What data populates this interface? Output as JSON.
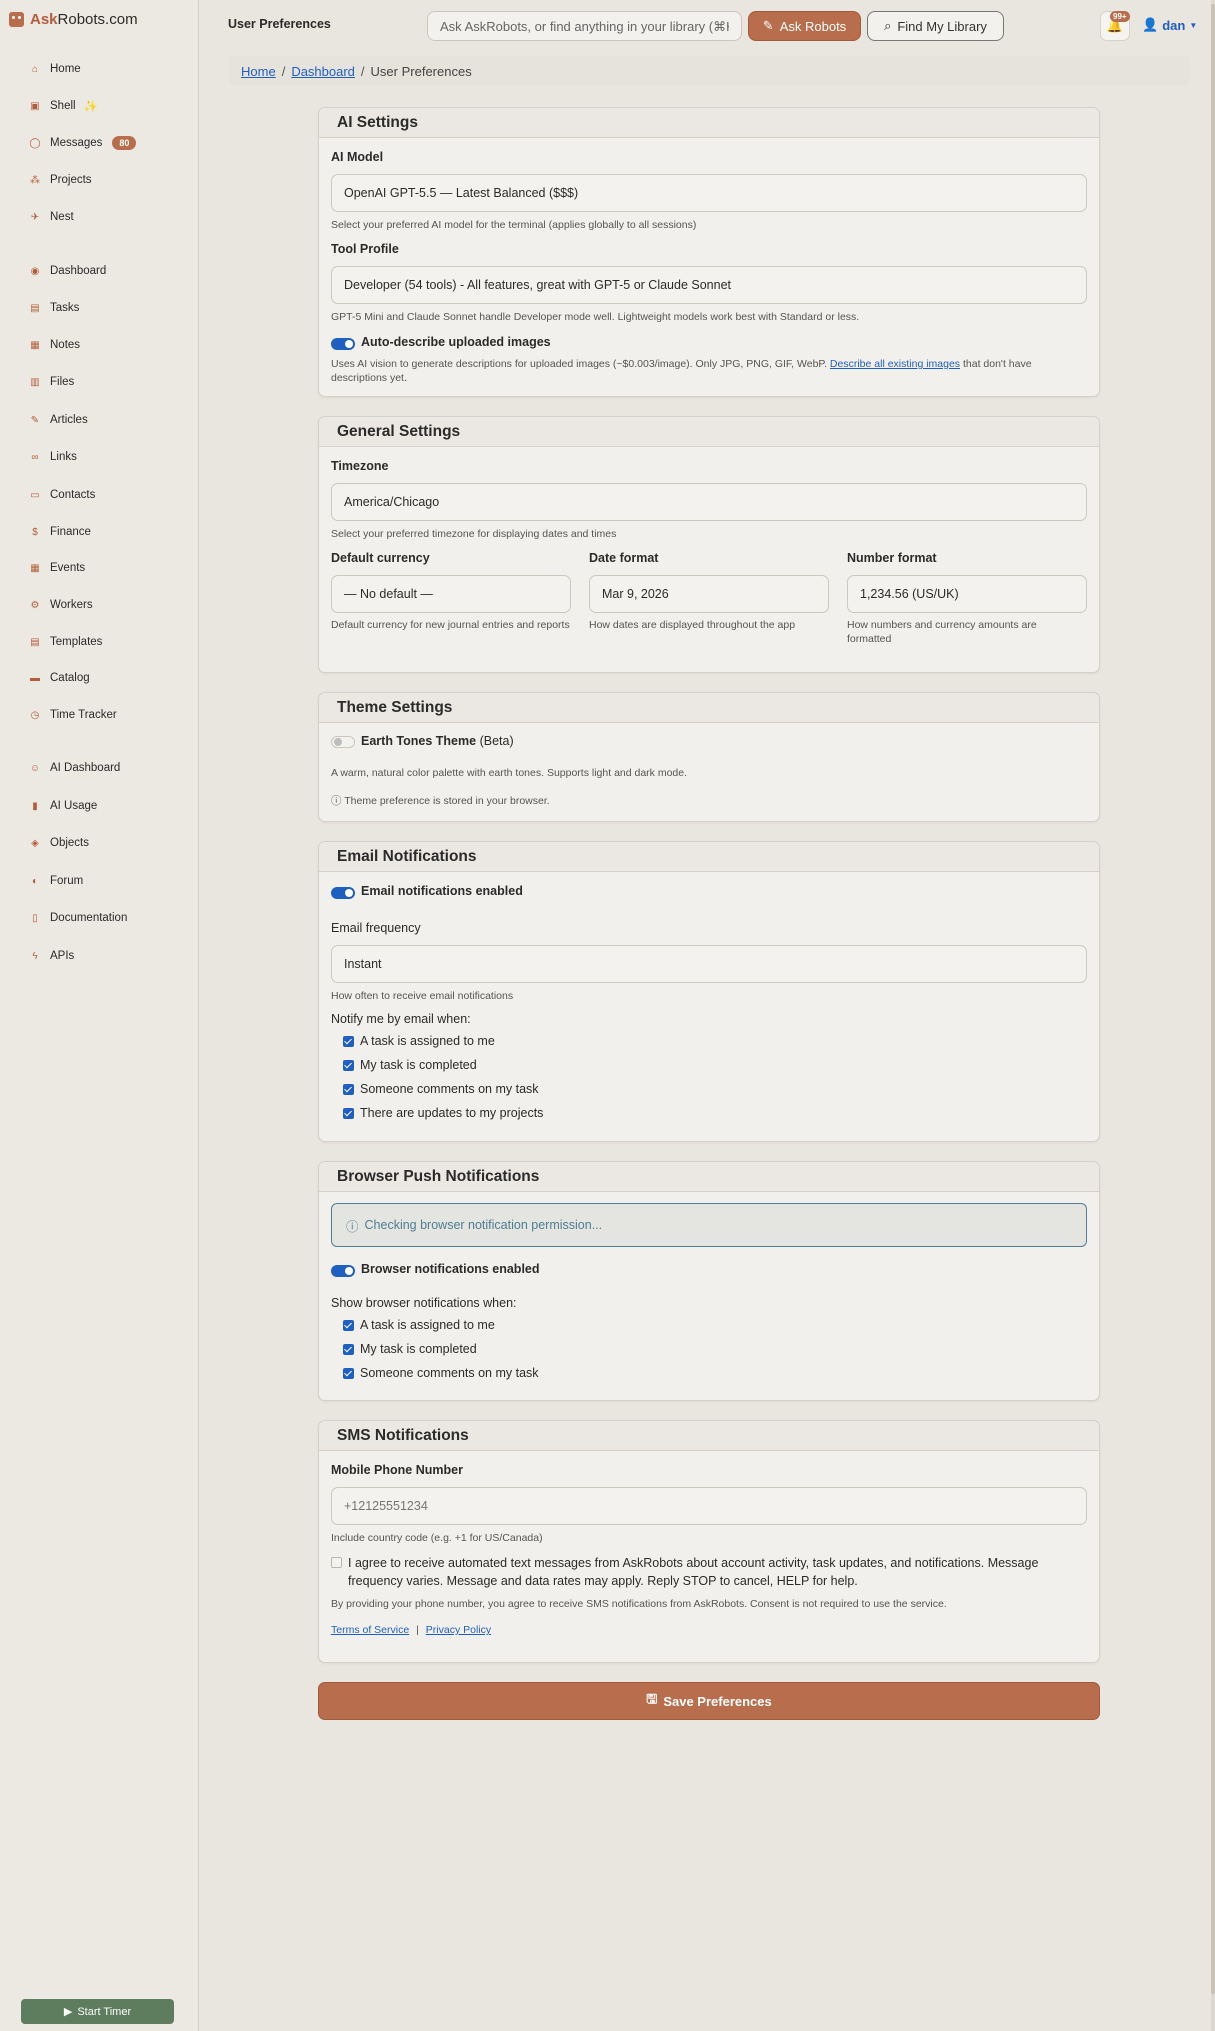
{
  "brand": {
    "name": "AskRobots.com"
  },
  "sidebar": {
    "items": [
      {
        "label": "Home",
        "icon": "home-icon",
        "glyph": "⌂"
      },
      {
        "label": "Shell",
        "icon": "shell-icon",
        "glyph": "▣",
        "extra": "✨"
      },
      {
        "label": "Messages",
        "icon": "chat-icon",
        "glyph": "◯",
        "badge": "80"
      },
      {
        "label": "Projects",
        "icon": "projects-icon",
        "glyph": "⁂"
      },
      {
        "label": "Nest",
        "icon": "bird-icon",
        "glyph": "✈"
      },
      {
        "label": "Dashboard",
        "icon": "dashboard-icon",
        "glyph": "◉"
      },
      {
        "label": "Tasks",
        "icon": "tasks-icon",
        "glyph": "▤"
      },
      {
        "label": "Notes",
        "icon": "notes-icon",
        "glyph": "▦"
      },
      {
        "label": "Files",
        "icon": "files-icon",
        "glyph": "▥"
      },
      {
        "label": "Articles",
        "icon": "articles-icon",
        "glyph": "✎"
      },
      {
        "label": "Links",
        "icon": "links-icon",
        "glyph": "∞"
      },
      {
        "label": "Contacts",
        "icon": "contacts-icon",
        "glyph": "▭"
      },
      {
        "label": "Finance",
        "icon": "dollar-icon",
        "glyph": "$"
      },
      {
        "label": "Events",
        "icon": "calendar-icon",
        "glyph": "▦"
      },
      {
        "label": "Workers",
        "icon": "workers-icon",
        "glyph": "⚙"
      },
      {
        "label": "Templates",
        "icon": "templates-icon",
        "glyph": "▤"
      },
      {
        "label": "Catalog",
        "icon": "catalog-icon",
        "glyph": "▬"
      },
      {
        "label": "Time Tracker",
        "icon": "stopwatch-icon",
        "glyph": "◷"
      },
      {
        "label": "AI Dashboard",
        "icon": "robot-icon",
        "glyph": "☺"
      },
      {
        "label": "AI Usage",
        "icon": "usage-chart-icon",
        "glyph": "▮"
      },
      {
        "label": "Objects",
        "icon": "objects-icon",
        "glyph": "◈"
      },
      {
        "label": "Forum",
        "icon": "forum-icon",
        "glyph": "◐"
      },
      {
        "label": "Documentation",
        "icon": "book-icon",
        "glyph": "▯"
      },
      {
        "label": "APIs",
        "icon": "api-icon",
        "glyph": "ϟ"
      }
    ],
    "start_timer": "Start Timer"
  },
  "header": {
    "title": "User Preferences",
    "search_placeholder": "Ask AskRobots, or find anything in your library (⌘K",
    "ask_button": "Ask Robots",
    "find_button": "Find My Library",
    "notif_badge": "99+",
    "user": "dan"
  },
  "breadcrumb": {
    "home": "Home",
    "dashboard": "Dashboard",
    "current": "User Preferences",
    "sep": "/"
  },
  "ai_settings": {
    "title": "AI Settings",
    "model_label": "AI Model",
    "model_value": "OpenAI GPT-5.5 — Latest Balanced ($$$)",
    "model_help": "Select your preferred AI model for the terminal (applies globally to all sessions)",
    "profile_label": "Tool Profile",
    "profile_value": "Developer (54 tools) - All features, great with GPT-5 or Claude Sonnet",
    "profile_help": "GPT-5 Mini and Claude Sonnet handle Developer mode well. Lightweight models work best with Standard or less.",
    "autodescribe_label": "Auto-describe uploaded images",
    "autodescribe_help": "Uses AI vision to generate descriptions for uploaded images (~$0.003/image). Only JPG, PNG, GIF, WebP.",
    "autodescribe_link": "Describe all existing images",
    "autodescribe_tail": "that don't have",
    "autodescribe_tail2": "descriptions yet."
  },
  "general_settings": {
    "title": "General Settings",
    "timezone_label": "Timezone",
    "timezone_value": "America/Chicago",
    "timezone_help": "Select your preferred timezone for displaying dates and times",
    "currency_label": "Default currency",
    "currency_value": "— No default —",
    "currency_help": "Default currency for new journal entries and reports",
    "date_label": "Date format",
    "date_value": "Mar 9, 2026",
    "date_help": "How dates are displayed throughout the app",
    "number_label": "Number format",
    "number_value": "1,234.56 (US/UK)",
    "number_help": "How numbers and currency amounts are formatted"
  },
  "theme_settings": {
    "title": "Theme Settings",
    "theme_label": "Earth Tones Theme",
    "theme_beta": "(Beta)",
    "theme_desc": "A warm, natural color palette with earth tones. Supports light and dark mode.",
    "theme_note": "Theme preference is stored in your browser."
  },
  "email_notifications": {
    "title": "Email Notifications",
    "enabled_label": "Email notifications enabled",
    "frequency_label": "Email frequency",
    "frequency_value": "Instant",
    "frequency_help": "How often to receive email notifications",
    "notify_label": "Notify me by email when:",
    "options": [
      "A task is assigned to me",
      "My task is completed",
      "Someone comments on my task",
      "There are updates to my projects"
    ]
  },
  "push_notifications": {
    "title": "Browser Push Notifications",
    "status": "Checking browser notification permission...",
    "enabled_label": "Browser notifications enabled",
    "show_label": "Show browser notifications when:",
    "options": [
      "A task is assigned to me",
      "My task is completed",
      "Someone comments on my task"
    ]
  },
  "sms_notifications": {
    "title": "SMS Notifications",
    "phone_label": "Mobile Phone Number",
    "phone_placeholder": "+12125551234",
    "phone_help": "Include country code (e.g. +1 for US/Canada)",
    "consent_line1": "I agree to receive automated text messages from AskRobots about account activity, task updates, and notifications. Message",
    "consent_line2": "frequency varies. Message and data rates may apply. Reply STOP to cancel, HELP for help.",
    "consent_note": "By providing your phone number, you agree to receive SMS notifications from AskRobots. Consent is not required to use the service.",
    "terms": "Terms of Service",
    "divider": "|",
    "privacy": "Privacy Policy"
  },
  "save_button": "Save Preferences",
  "colors": {
    "accent": "#b86d4c",
    "link": "#1f5fbf",
    "timer": "#5e7d5e"
  }
}
